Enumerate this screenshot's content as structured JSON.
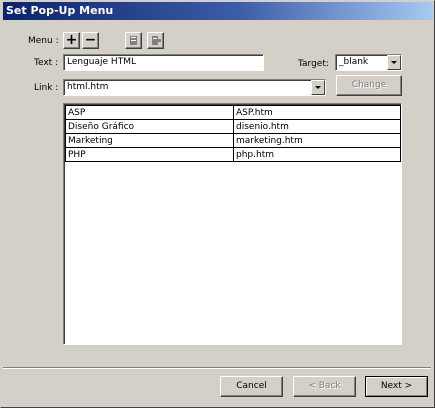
{
  "window": {
    "title": "Set Pop-Up Menu"
  },
  "menu_label": "Menu :",
  "menu_buttons": {
    "add": "+",
    "remove": "−"
  },
  "text_field": {
    "label": "Text :",
    "value": "Lenguaje HTML"
  },
  "target": {
    "label": "Target:",
    "value": "_blank"
  },
  "link": {
    "label": "Link :",
    "value": "html.htm"
  },
  "change_button": "Change",
  "items": [
    {
      "text": "ASP",
      "link": "ASP.htm"
    },
    {
      "text": "Diseño Gráfico",
      "link": "disenio.htm"
    },
    {
      "text": "Marketing",
      "link": "marketing.htm"
    },
    {
      "text": "PHP",
      "link": "php.htm"
    }
  ],
  "footer": {
    "cancel": "Cancel",
    "back": "< Back",
    "next": "Next >"
  }
}
